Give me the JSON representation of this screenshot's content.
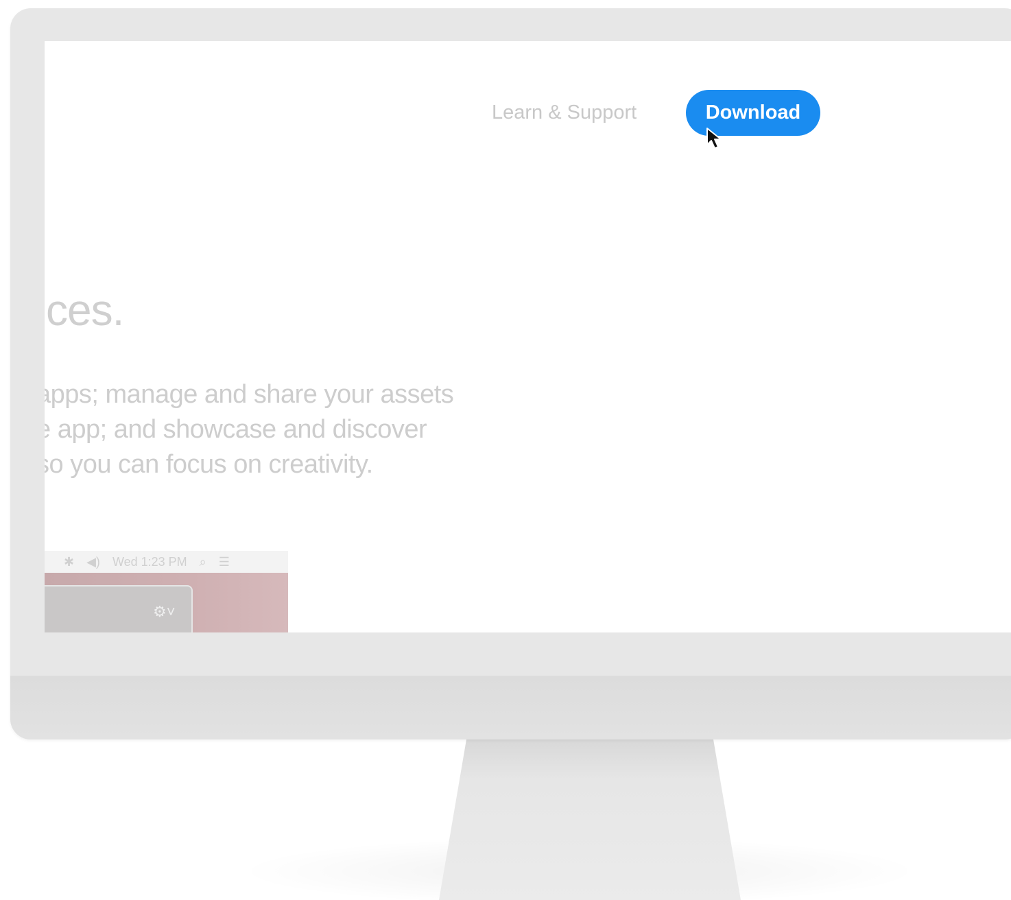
{
  "nav": {
    "learn_support": "Learn & Support",
    "download": "Download"
  },
  "hero": {
    "headline": "/ices.",
    "body_lines": [
      "apps; manage and share your assets",
      "e app; and showcase and discover",
      "so you can focus on creativity."
    ]
  },
  "mini_screen": {
    "menubar_items": [
      "⌕",
      "✱",
      "◀)",
      "Wed 1:23 PM",
      "⌕",
      "☰"
    ],
    "clock": "Wed 1:23 PM",
    "gear": "⚙˅"
  },
  "colors": {
    "accent": "#1a8cf0",
    "bezel": "#e7e7e7",
    "muted_text": "#cdcdcd"
  },
  "icons": {
    "cursor": "arrow-cursor-icon",
    "gear": "gear-icon",
    "search": "search-icon",
    "list": "list-icon"
  }
}
